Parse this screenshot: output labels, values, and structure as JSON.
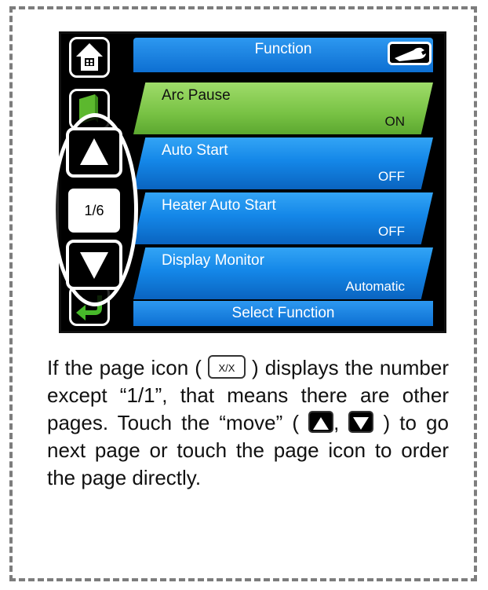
{
  "screen": {
    "title": "Function",
    "footer": "Select Function",
    "rows": [
      {
        "label": "Arc Pause",
        "value": "ON",
        "selected": true
      },
      {
        "label": "Auto Start",
        "value": "OFF",
        "selected": false
      },
      {
        "label": "Heater Auto Start",
        "value": "OFF",
        "selected": false
      },
      {
        "label": "Display Monitor",
        "value": "Automatic",
        "selected": false
      }
    ],
    "pager": {
      "page": "1/6"
    }
  },
  "description": {
    "part1": "If the page icon (",
    "page_icon_label": "X/X",
    "part2": ") displays the number except “1/1”, that means there are other pages. Touch the “move” (",
    "sep": ",",
    "part3": ") to go next page or touch the page icon to order the page directly."
  },
  "colors": {
    "row_blue": "#1487e8",
    "row_selected_green": "#78c244",
    "screen_background": "#000000",
    "frame_dash": "#7d7d7d"
  },
  "icons": {
    "home": "home-icon",
    "wrench": "wrench-icon",
    "book": "book-icon",
    "up": "up-arrow-icon",
    "down": "down-arrow-icon",
    "back": "return-arrow-icon"
  }
}
